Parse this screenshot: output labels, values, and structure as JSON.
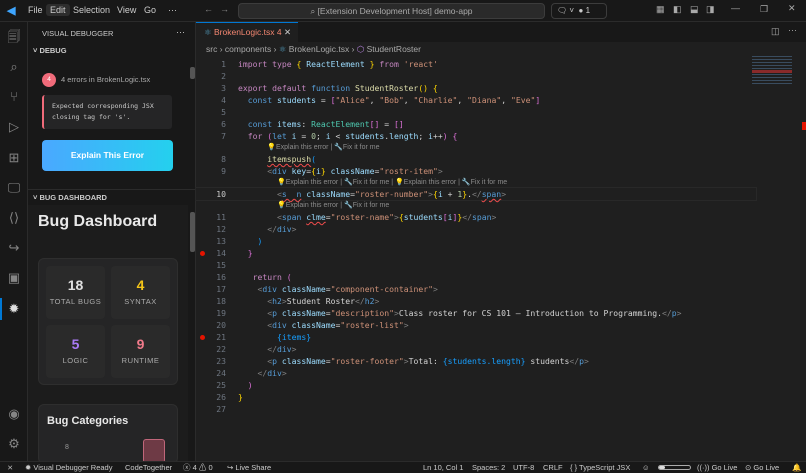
{
  "menu": [
    "File",
    "Edit",
    "Selection",
    "View",
    "Go",
    "···"
  ],
  "search": "[Extension Development Host] demo-app",
  "title_badge": "1",
  "sidebar": {
    "title": "VISUAL DEBUGGER",
    "more": "···",
    "debug_section": "DEBUG",
    "error_count": "4",
    "error_summary": "4 errors in BrokenLogic.tsx",
    "error_message": "Expected corresponding JSX closing tag for 's'.",
    "explain_button": "Explain This Error",
    "dashboard_section": "BUG DASHBOARD",
    "dashboard_title": "Bug Dashboard",
    "stats": [
      {
        "value": "18",
        "label": "TOTAL BUGS",
        "color": "#e0e0e0"
      },
      {
        "value": "4",
        "label": "SYNTAX",
        "color": "#f5c518"
      },
      {
        "value": "5",
        "label": "LOGIC",
        "color": "#a97bf5"
      },
      {
        "value": "9",
        "label": "RUNTIME",
        "color": "#f07a8a"
      }
    ],
    "categories_title": "Bug Categories",
    "categories_axis": "8"
  },
  "editor": {
    "tab": "BrokenLogic.tsx",
    "tab_count": "4",
    "breadcrumb": [
      "src",
      "components",
      "BrokenLogic.tsx",
      "StudentRoster"
    ],
    "hint_single": "💡Explain this error | 🔧Fix it for me",
    "hint_double": "💡Explain this error | 🔧Fix it for me | 💡Explain this error | 🔧Fix it for me",
    "lines": [
      {
        "n": "1",
        "seg": [
          [
            "import type ",
            "k"
          ],
          [
            "{ ",
            "y"
          ],
          [
            "ReactElement ",
            "v"
          ],
          [
            "}",
            "y"
          ],
          [
            " from ",
            "k"
          ],
          [
            "'react'",
            "s"
          ]
        ]
      },
      {
        "n": "2",
        "seg": []
      },
      {
        "n": "3",
        "seg": [
          [
            "export default ",
            "k"
          ],
          [
            "function ",
            "b"
          ],
          [
            "StudentRoster",
            "f"
          ],
          [
            "() {",
            "y"
          ]
        ]
      },
      {
        "n": "4",
        "seg": [
          [
            "  const ",
            "b"
          ],
          [
            "students ",
            "v"
          ],
          [
            "= "
          ],
          [
            "[",
            "p"
          ],
          [
            "\"Alice\"",
            "s"
          ],
          [
            ", "
          ],
          [
            "\"Bob\"",
            "s"
          ],
          [
            ", "
          ],
          [
            "\"Charlie\"",
            "s"
          ],
          [
            ", "
          ],
          [
            "\"Diana\"",
            "s"
          ],
          [
            ", "
          ],
          [
            "\"Eve\"",
            "s"
          ],
          [
            "]",
            "p"
          ]
        ]
      },
      {
        "n": "5",
        "seg": []
      },
      {
        "n": "6",
        "seg": [
          [
            "  const ",
            "b"
          ],
          [
            "items",
            "v"
          ],
          [
            ": "
          ],
          [
            "ReactElement",
            "t"
          ],
          [
            "[]",
            "p"
          ],
          [
            " = "
          ],
          [
            "[]",
            "p"
          ]
        ]
      },
      {
        "n": "7",
        "seg": [
          [
            "  for ",
            "k"
          ],
          [
            "(",
            "p"
          ],
          [
            "let ",
            "b"
          ],
          [
            "i ",
            "v"
          ],
          [
            "= "
          ],
          [
            "0",
            "n"
          ],
          [
            "; "
          ],
          [
            "i ",
            "v"
          ],
          [
            "< "
          ],
          [
            "students",
            "v"
          ],
          [
            "."
          ],
          [
            "length",
            "v"
          ],
          [
            "; "
          ],
          [
            "i",
            "v"
          ],
          [
            "++"
          ],
          [
            ")",
            "p"
          ],
          [
            " {",
            "p"
          ]
        ],
        "hint": "single",
        "hint_indent": "      "
      },
      {
        "n": "8",
        "seg": [
          [
            "      "
          ],
          [
            "itemspush",
            "f err"
          ],
          [
            "(",
            "c"
          ]
        ]
      },
      {
        "n": "9",
        "seg": [
          [
            "      "
          ],
          [
            "<",
            "g"
          ],
          [
            "div ",
            "b"
          ],
          [
            "key",
            "v"
          ],
          [
            "="
          ],
          [
            "{",
            "y"
          ],
          [
            "i",
            "v"
          ],
          [
            "}",
            "y"
          ],
          [
            " "
          ],
          [
            "className",
            "v"
          ],
          [
            "="
          ],
          [
            "\"rostr-item\"",
            "s"
          ],
          [
            ">",
            "g"
          ]
        ],
        "hint": "double",
        "hint_indent": "        "
      },
      {
        "n": "10",
        "cur": true,
        "seg": [
          [
            "        "
          ],
          [
            "<",
            "g"
          ],
          [
            "s  n",
            "b err"
          ],
          [
            " "
          ],
          [
            "className",
            "v"
          ],
          [
            "="
          ],
          [
            "\"roster-number\"",
            "s"
          ],
          [
            ">",
            "g"
          ],
          [
            "{",
            "y"
          ],
          [
            "i ",
            "v"
          ],
          [
            "+ "
          ],
          [
            "1",
            "n"
          ],
          [
            "}",
            "y"
          ],
          [
            "."
          ],
          [
            "</",
            "g"
          ],
          [
            "span",
            "b err"
          ],
          [
            ">",
            "g"
          ]
        ],
        "hint": "single",
        "hint_indent": "        "
      },
      {
        "n": "11",
        "seg": [
          [
            "        "
          ],
          [
            "<",
            "g"
          ],
          [
            "span ",
            "b"
          ],
          [
            "clme",
            "v err"
          ],
          [
            "="
          ],
          [
            "\"roster-name\"",
            "s"
          ],
          [
            ">",
            "g"
          ],
          [
            "{",
            "y"
          ],
          [
            "students",
            "v"
          ],
          [
            "[",
            "p"
          ],
          [
            "i",
            "v"
          ],
          [
            "]",
            "p"
          ],
          [
            "}",
            "y"
          ],
          [
            "</",
            "g"
          ],
          [
            "span",
            "b"
          ],
          [
            ">",
            "g"
          ]
        ]
      },
      {
        "n": "12",
        "seg": [
          [
            "      "
          ],
          [
            "</",
            "g"
          ],
          [
            "div",
            "b"
          ],
          [
            ">",
            "g"
          ]
        ]
      },
      {
        "n": "13",
        "seg": [
          [
            "    "
          ],
          [
            ")",
            "c"
          ]
        ]
      },
      {
        "n": "14",
        "bp": true,
        "seg": [
          [
            "  "
          ],
          [
            "}",
            "p"
          ]
        ]
      },
      {
        "n": "15",
        "seg": []
      },
      {
        "n": "16",
        "seg": [
          [
            "   return ",
            "k"
          ],
          [
            "(",
            "p"
          ]
        ]
      },
      {
        "n": "17",
        "seg": [
          [
            "    "
          ],
          [
            "<",
            "g"
          ],
          [
            "div ",
            "b"
          ],
          [
            "className",
            "v"
          ],
          [
            "="
          ],
          [
            "\"component-container\"",
            "s"
          ],
          [
            ">",
            "g"
          ]
        ]
      },
      {
        "n": "18",
        "seg": [
          [
            "      "
          ],
          [
            "<",
            "g"
          ],
          [
            "h2",
            "b"
          ],
          [
            ">",
            "g"
          ],
          [
            "Student Roster"
          ],
          [
            "</",
            "g"
          ],
          [
            "h2",
            "b"
          ],
          [
            ">",
            "g"
          ]
        ]
      },
      {
        "n": "19",
        "seg": [
          [
            "      "
          ],
          [
            "<",
            "g"
          ],
          [
            "p ",
            "b"
          ],
          [
            "className",
            "v"
          ],
          [
            "="
          ],
          [
            "\"description\"",
            "s"
          ],
          [
            ">",
            "g"
          ],
          [
            "Class roster for CS 101 — Introduction to Programming."
          ],
          [
            "</",
            "g"
          ],
          [
            "p",
            "b"
          ],
          [
            ">",
            "g"
          ]
        ]
      },
      {
        "n": "20",
        "seg": [
          [
            "      "
          ],
          [
            "<",
            "g"
          ],
          [
            "div ",
            "b"
          ],
          [
            "className",
            "v"
          ],
          [
            "="
          ],
          [
            "\"roster-list\"",
            "s"
          ],
          [
            ">",
            "g"
          ]
        ]
      },
      {
        "n": "21",
        "bp": true,
        "seg": [
          [
            "        "
          ],
          [
            "{items}",
            "c"
          ]
        ]
      },
      {
        "n": "22",
        "seg": [
          [
            "      "
          ],
          [
            "</",
            "g"
          ],
          [
            "div",
            "b"
          ],
          [
            ">",
            "g"
          ]
        ]
      },
      {
        "n": "23",
        "seg": [
          [
            "      "
          ],
          [
            "<",
            "g"
          ],
          [
            "p ",
            "b"
          ],
          [
            "className",
            "v"
          ],
          [
            "="
          ],
          [
            "\"roster-footer\"",
            "s"
          ],
          [
            ">",
            "g"
          ],
          [
            "Total: "
          ],
          [
            "{students.length}",
            "c"
          ],
          [
            " students"
          ],
          [
            "</",
            "g"
          ],
          [
            "p",
            "b"
          ],
          [
            ">",
            "g"
          ]
        ]
      },
      {
        "n": "24",
        "seg": [
          [
            "    "
          ],
          [
            "</",
            "g"
          ],
          [
            "div",
            "b"
          ],
          [
            ">",
            "g"
          ]
        ]
      },
      {
        "n": "25",
        "seg": [
          [
            "  "
          ],
          [
            ")",
            "p"
          ]
        ]
      },
      {
        "n": "26",
        "seg": [
          [
            "}",
            "y"
          ]
        ]
      },
      {
        "n": "27",
        "seg": []
      }
    ]
  },
  "status": {
    "ready": "Visual Debugger Ready",
    "codetogether": "CodeTogether",
    "errors": "4",
    "warnings": "0",
    "liveshare": "Live Share",
    "position": "Ln 10, Col 1",
    "spaces": "Spaces: 2",
    "encoding": "UTF-8",
    "eol": "CRLF",
    "language": "TypeScript JSX",
    "golive1": "Go Live",
    "golive2": "Go Live"
  }
}
